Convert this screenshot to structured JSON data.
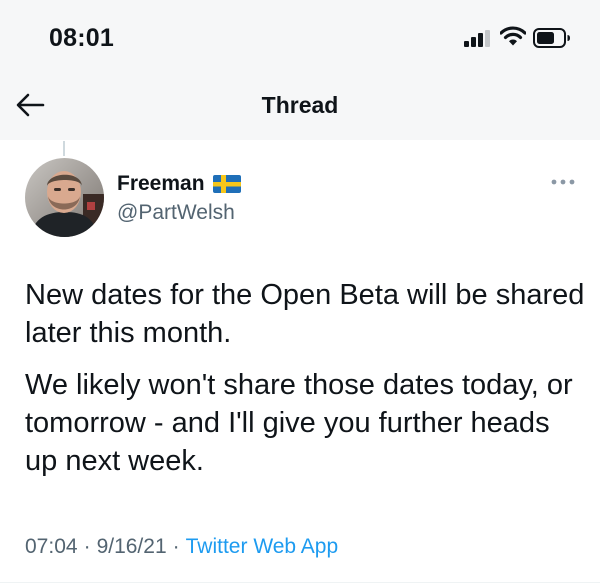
{
  "status_bar": {
    "time": "08:01",
    "signal_bars_active": 3,
    "signal_bars_total": 4,
    "icons": [
      "cellular-signal-icon",
      "wifi-icon",
      "battery-icon"
    ]
  },
  "header": {
    "title": "Thread",
    "back_icon": "back-arrow-icon"
  },
  "tweet": {
    "author": {
      "display_name": "Freeman",
      "handle": "@PartWelsh",
      "flag": "sweden-flag-emoji"
    },
    "paragraphs": [
      "New dates for the Open Beta will be shared later this month.",
      "We likely won't share those dates today, or tomorrow - and I'll give you further heads up next week."
    ],
    "meta": {
      "time": "07:04",
      "separator": "·",
      "date": "9/16/21",
      "source": "Twitter Web App"
    }
  },
  "colors": {
    "text": "#0f1419",
    "secondary": "#536471",
    "accent": "#1d9bf0",
    "top_background": "#f6f7f8"
  }
}
